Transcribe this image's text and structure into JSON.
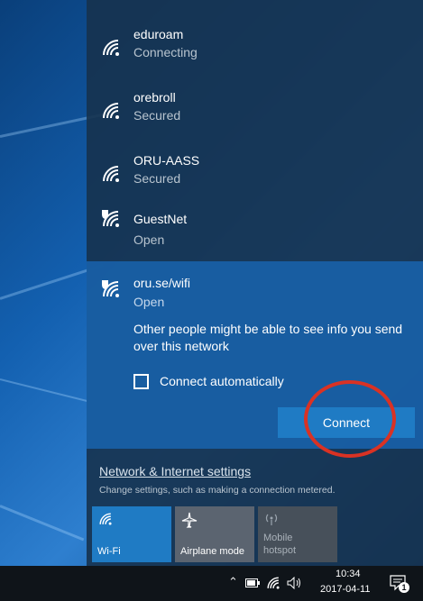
{
  "networks": [
    {
      "name": "eduroam",
      "status": "Connecting",
      "icon": "wifi-icon"
    },
    {
      "name": "orebroll",
      "status": "Secured",
      "icon": "wifi-icon"
    },
    {
      "name": "ORU-AASS",
      "status": "Secured",
      "icon": "wifi-icon"
    },
    {
      "name": "GuestNet",
      "status": "Open",
      "icon": "wifi-shield-icon"
    }
  ],
  "selected_network": {
    "name": "oru.se/wifi",
    "status": "Open",
    "warning": "Other people might be able to see info you send over this network",
    "connect_auto_label": "Connect automatically",
    "connect_auto_checked": false,
    "connect_button": "Connect"
  },
  "settings": {
    "title": "Network & Internet settings",
    "description": "Change settings, such as making a connection metered."
  },
  "quick_actions": [
    {
      "label": "Wi-Fi",
      "icon": "wifi-icon",
      "active": true
    },
    {
      "label": "Airplane mode",
      "icon": "airplane-icon",
      "active": false
    },
    {
      "label": "Mobile hotspot",
      "icon": "hotspot-icon",
      "active": false,
      "disabled": true
    }
  ],
  "taskbar": {
    "time": "10:34",
    "date": "2017-04-11",
    "notification_count": "1"
  },
  "colors": {
    "accent": "#1f7bc4",
    "selected_bg": "#185fa5",
    "panel_bg": "#16324e",
    "highlight_ring": "#d93224"
  }
}
